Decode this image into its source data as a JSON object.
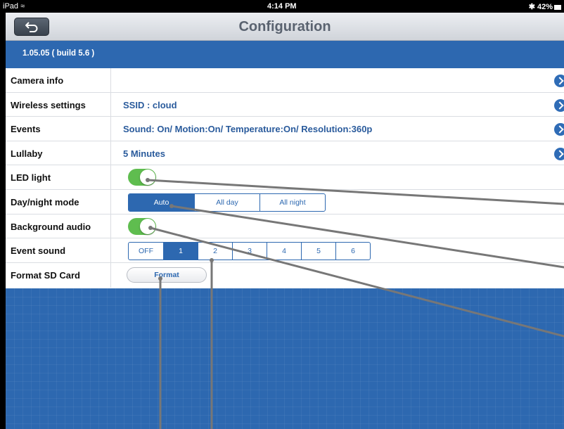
{
  "status_bar": {
    "device": "iPad",
    "time": "4:14 PM",
    "battery": "42%"
  },
  "nav": {
    "title": "Configuration"
  },
  "version": "1.05.05 ( build 5.6 )",
  "rows": {
    "camera_info": {
      "label": "Camera info"
    },
    "wireless": {
      "label": "Wireless settings",
      "value": "SSID : cloud"
    },
    "events": {
      "label": "Events",
      "value": "Sound: On/ Motion:On/ Temperature:On/ Resolution:360p"
    },
    "lullaby": {
      "label": "Lullaby",
      "value": "5 Minutes"
    },
    "led": {
      "label": "LED light",
      "on": true
    },
    "day_night": {
      "label": "Day/night mode",
      "options": [
        "Auto",
        "All day",
        "All night"
      ],
      "selected": "Auto"
    },
    "background_audio": {
      "label": "Background audio",
      "on": true
    },
    "event_sound": {
      "label": "Event sound",
      "options": [
        "OFF",
        "1",
        "2",
        "3",
        "4",
        "5",
        "6"
      ],
      "selected": "1"
    },
    "format_sd": {
      "label": "Format SD Card",
      "button": "Format"
    }
  },
  "colors": {
    "accent": "#2d68b0",
    "toggle_on": "#5fbd4f"
  },
  "icons": [
    "wifi-icon",
    "bluetooth-icon",
    "battery-icon",
    "back-arrow-icon",
    "disclosure-chevron-icon"
  ]
}
